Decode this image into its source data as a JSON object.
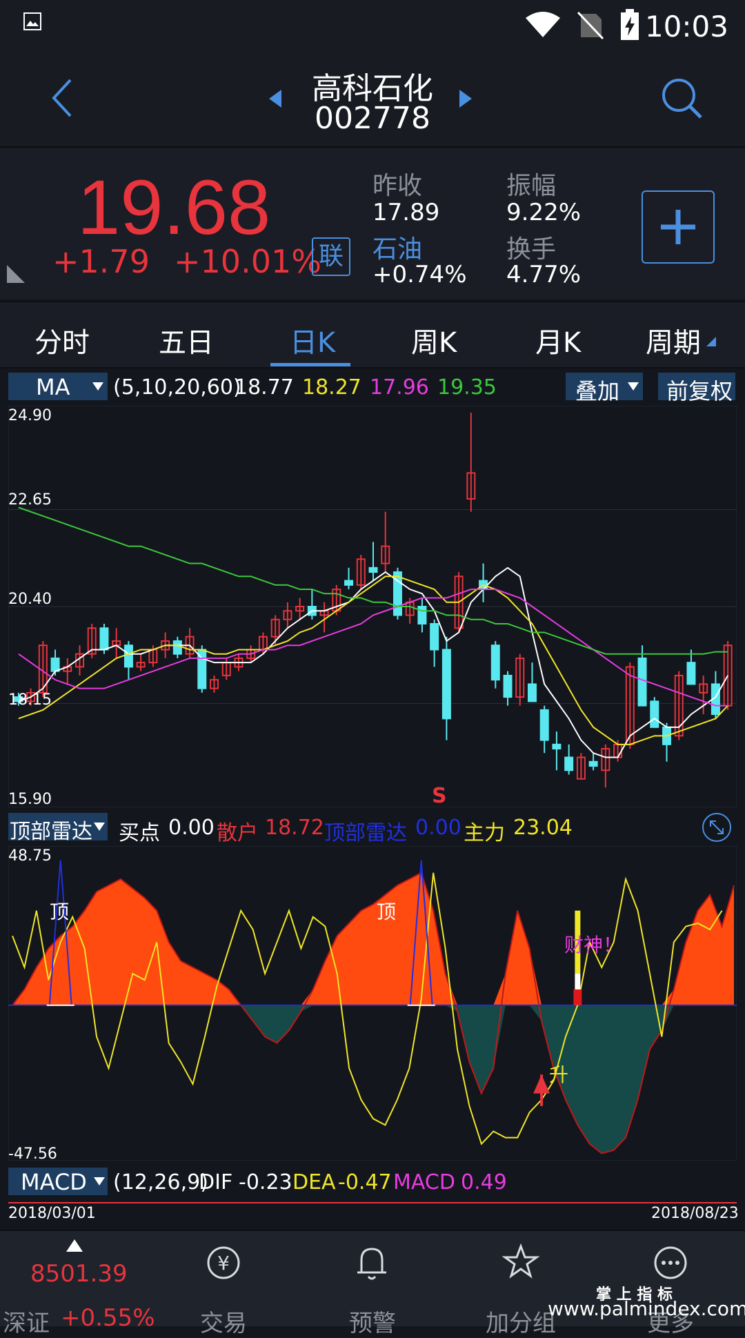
{
  "status": {
    "time": "10:03"
  },
  "nav": {
    "stock_name": "高科石化",
    "stock_code": "002778"
  },
  "quote": {
    "price": "19.68",
    "change": "+1.79",
    "change_pct": "+10.01%",
    "lian": "联",
    "prev_close_label": "昨收",
    "prev_close": "17.89",
    "amplitude_label": "振幅",
    "amplitude": "9.22%",
    "sector_label": "石油",
    "sector_change": "+0.74%",
    "turnover_label": "换手",
    "turnover": "4.77%"
  },
  "tabs": [
    "分时",
    "五日",
    "日K",
    "周K",
    "月K",
    "周期"
  ],
  "active_tab": 2,
  "ma_bar": {
    "selector": "MA",
    "params": "(5,10,20,60)",
    "v1": "18.77",
    "v2": "18.27",
    "v3": "17.96",
    "v4": "19.35",
    "overlay": "叠加",
    "adjust": "前复权"
  },
  "kline_axis": {
    "labels": [
      "24.90",
      "22.65",
      "20.40",
      "18.15",
      "15.90"
    ],
    "s_mark": "S"
  },
  "radar_bar": {
    "selector": "顶部雷达",
    "buy_label": "买点",
    "buy_val": "0.00",
    "retail_label": "散户",
    "retail_val": "18.72",
    "top_label": "顶部雷达",
    "top_val": "0.00",
    "main_label": "主力",
    "main_val": "23.04"
  },
  "radar_axis": {
    "top": "48.75",
    "bottom": "-47.56",
    "ding1": "顶",
    "ding2": "顶",
    "caishen": "财神！",
    "sheng": "升"
  },
  "macd_bar": {
    "selector": "MACD",
    "params": "(12,26,9)",
    "dif_label": "DIF",
    "dif": "-0.23",
    "dea_label": "DEA",
    "dea": "-0.47",
    "macd_label": "MACD",
    "macd": "0.49"
  },
  "dates": {
    "start": "2018/03/01",
    "end": "2018/08/23"
  },
  "bottom_nav": {
    "index_val": "8501.39",
    "index_name": "深证",
    "index_chg": "+0.55%",
    "trade": "交易",
    "alert": "预警",
    "group": "加分组",
    "more": "更多"
  },
  "watermark": {
    "line1": "掌 上 指 标",
    "line2": "www.palmindex.com"
  },
  "colors": {
    "up": "#e8343c",
    "down": "#59e8f0",
    "accent": "#4a8fe0",
    "ma5": "#ffffff",
    "ma10": "#f0e628",
    "ma20": "#e83ce0",
    "ma60": "#3cc83c"
  },
  "chart_data": {
    "type": "candlestick",
    "ylim": [
      15.9,
      24.9
    ],
    "ma_ylim_note": "",
    "candles": [
      [
        18.3,
        18.4,
        18.1,
        18.2
      ],
      [
        18.2,
        18.5,
        18.1,
        18.4
      ],
      [
        18.4,
        19.6,
        18.3,
        19.5
      ],
      [
        19.2,
        19.4,
        18.8,
        18.9
      ],
      [
        18.9,
        19.2,
        18.6,
        19.0
      ],
      [
        19.0,
        19.5,
        18.8,
        19.3
      ],
      [
        19.3,
        20.0,
        19.2,
        19.9
      ],
      [
        19.9,
        20.0,
        19.3,
        19.4
      ],
      [
        19.5,
        19.9,
        19.2,
        19.6
      ],
      [
        19.5,
        19.6,
        18.7,
        19.0
      ],
      [
        19.0,
        19.3,
        18.9,
        19.1
      ],
      [
        19.1,
        19.5,
        19.0,
        19.4
      ],
      [
        19.4,
        19.8,
        19.2,
        19.6
      ],
      [
        19.6,
        19.7,
        19.2,
        19.3
      ],
      [
        19.3,
        19.9,
        19.2,
        19.7
      ],
      [
        19.4,
        19.5,
        18.4,
        18.5
      ],
      [
        18.5,
        18.8,
        18.4,
        18.7
      ],
      [
        18.8,
        19.2,
        18.7,
        19.1
      ],
      [
        19.0,
        19.3,
        18.9,
        19.2
      ],
      [
        19.2,
        19.5,
        19.1,
        19.4
      ],
      [
        19.4,
        19.8,
        19.3,
        19.7
      ],
      [
        19.7,
        20.2,
        19.5,
        20.1
      ],
      [
        20.1,
        20.5,
        19.9,
        20.3
      ],
      [
        20.3,
        20.6,
        20.1,
        20.4
      ],
      [
        20.4,
        20.8,
        20.1,
        20.2
      ],
      [
        20.2,
        20.5,
        19.8,
        20.3
      ],
      [
        20.3,
        20.9,
        20.2,
        20.8
      ],
      [
        21.0,
        21.3,
        20.8,
        20.9
      ],
      [
        20.9,
        21.6,
        20.8,
        21.5
      ],
      [
        21.3,
        21.9,
        21.0,
        21.2
      ],
      [
        21.4,
        22.6,
        21.2,
        21.8
      ],
      [
        21.2,
        21.3,
        20.1,
        20.2
      ],
      [
        20.2,
        20.6,
        20.0,
        20.5
      ],
      [
        20.4,
        20.6,
        19.8,
        20.0
      ],
      [
        20.0,
        20.1,
        19.0,
        19.4
      ],
      [
        19.4,
        19.7,
        17.3,
        17.8
      ],
      [
        19.9,
        21.2,
        19.8,
        21.1
      ],
      [
        22.9,
        24.9,
        22.6,
        23.5
      ],
      [
        21.0,
        21.4,
        20.5,
        20.8
      ],
      [
        19.5,
        19.6,
        18.5,
        18.7
      ],
      [
        18.8,
        18.9,
        18.1,
        18.3
      ],
      [
        18.3,
        19.3,
        18.1,
        19.2
      ],
      [
        18.6,
        19.1,
        18.2,
        18.2
      ],
      [
        18.0,
        18.1,
        17.0,
        17.3
      ],
      [
        17.2,
        17.5,
        16.6,
        17.1
      ],
      [
        16.9,
        17.2,
        16.5,
        16.6
      ],
      [
        16.4,
        17.0,
        16.4,
        16.9
      ],
      [
        16.8,
        17.0,
        16.6,
        16.7
      ],
      [
        16.6,
        17.2,
        16.2,
        17.1
      ],
      [
        16.9,
        17.3,
        16.8,
        17.2
      ],
      [
        17.2,
        19.1,
        17.1,
        19.0
      ],
      [
        19.2,
        19.5,
        18.1,
        18.1
      ],
      [
        18.2,
        18.3,
        17.6,
        17.6
      ],
      [
        17.6,
        17.7,
        16.8,
        17.2
      ],
      [
        17.4,
        18.9,
        17.3,
        18.8
      ],
      [
        19.1,
        19.4,
        18.6,
        18.6
      ],
      [
        18.4,
        18.8,
        17.9,
        18.6
      ],
      [
        18.6,
        18.9,
        17.8,
        17.9
      ],
      [
        18.1,
        19.6,
        18.0,
        19.5
      ]
    ],
    "series": [
      {
        "name": "MA5",
        "values": [
          18.2,
          18.3,
          18.5,
          18.9,
          19.0,
          19.2,
          19.4,
          19.4,
          19.5,
          19.3,
          19.3,
          19.4,
          19.5,
          19.5,
          19.5,
          19.2,
          19.1,
          19.1,
          19.1,
          19.1,
          19.3,
          19.6,
          19.9,
          20.1,
          20.3,
          20.3,
          20.4,
          20.5,
          20.8,
          21.0,
          21.2,
          21.0,
          20.8,
          20.7,
          20.3,
          19.6,
          19.8,
          20.5,
          20.8,
          21.1,
          21.3,
          21.1,
          19.8,
          18.6,
          18.2,
          17.8,
          17.3,
          17.0,
          16.9,
          16.9,
          17.4,
          17.6,
          17.8,
          17.6,
          17.6,
          17.9,
          18.1,
          18.3,
          18.8
        ]
      },
      {
        "name": "MA10",
        "values": [
          17.8,
          17.9,
          18.0,
          18.2,
          18.4,
          18.6,
          18.8,
          19.0,
          19.2,
          19.3,
          19.4,
          19.4,
          19.5,
          19.5,
          19.4,
          19.4,
          19.3,
          19.3,
          19.4,
          19.4,
          19.4,
          19.5,
          19.6,
          19.8,
          19.9,
          20.1,
          20.3,
          20.5,
          20.7,
          20.9,
          21.1,
          21.1,
          21.0,
          20.9,
          20.8,
          20.5,
          20.5,
          20.7,
          20.9,
          20.8,
          20.6,
          20.3,
          20.0,
          19.5,
          19.0,
          18.5,
          18.0,
          17.6,
          17.4,
          17.2,
          17.2,
          17.3,
          17.4,
          17.4,
          17.5,
          17.6,
          17.7,
          17.8,
          18.1
        ]
      },
      {
        "name": "MA20",
        "values": [
          19.3,
          19.1,
          18.9,
          18.7,
          18.6,
          18.5,
          18.5,
          18.5,
          18.6,
          18.7,
          18.8,
          18.9,
          19.0,
          19.1,
          19.2,
          19.2,
          19.2,
          19.2,
          19.3,
          19.3,
          19.4,
          19.4,
          19.5,
          19.5,
          19.6,
          19.7,
          19.8,
          19.9,
          20.0,
          20.2,
          20.3,
          20.4,
          20.5,
          20.6,
          20.6,
          20.6,
          20.7,
          20.8,
          20.8,
          20.8,
          20.7,
          20.6,
          20.4,
          20.2,
          20.0,
          19.8,
          19.6,
          19.4,
          19.2,
          19.0,
          18.8,
          18.7,
          18.6,
          18.5,
          18.4,
          18.3,
          18.2,
          18.1,
          18.1
        ]
      },
      {
        "name": "MA60",
        "values": [
          22.7,
          22.6,
          22.5,
          22.4,
          22.3,
          22.2,
          22.1,
          22.0,
          21.9,
          21.8,
          21.8,
          21.7,
          21.6,
          21.5,
          21.4,
          21.4,
          21.3,
          21.2,
          21.1,
          21.1,
          21.0,
          20.9,
          20.9,
          20.8,
          20.8,
          20.7,
          20.7,
          20.6,
          20.6,
          20.5,
          20.5,
          20.4,
          20.4,
          20.3,
          20.3,
          20.2,
          20.2,
          20.1,
          20.1,
          20.0,
          20.0,
          19.9,
          19.8,
          19.8,
          19.7,
          19.6,
          19.5,
          19.4,
          19.3,
          19.3,
          19.3,
          19.3,
          19.3,
          19.3,
          19.3,
          19.3,
          19.3,
          19.35,
          19.35
        ]
      }
    ],
    "radar": {
      "ylim": [
        -47.56,
        48.75
      ],
      "area": [
        0,
        5,
        12,
        18,
        22,
        25,
        30,
        36,
        38,
        40,
        37,
        34,
        30,
        20,
        14,
        12,
        10,
        8,
        5,
        0,
        -5,
        -10,
        -12,
        -8,
        -2,
        5,
        14,
        22,
        26,
        30,
        32,
        35,
        38,
        40,
        42,
        30,
        10,
        -2,
        -18,
        -28,
        -20,
        10,
        30,
        18,
        -5,
        -20,
        -30,
        -38,
        -44,
        -47,
        -46,
        -42,
        -30,
        -14,
        -8,
        5,
        20,
        30,
        35,
        25,
        38
      ],
      "yellow": [
        22,
        12,
        30,
        8,
        20,
        28,
        18,
        -10,
        -20,
        -5,
        10,
        8,
        20,
        -12,
        -18,
        -25,
        -10,
        6,
        18,
        30,
        24,
        10,
        20,
        30,
        18,
        28,
        25,
        10,
        -20,
        -30,
        -36,
        -38,
        -30,
        -20,
        2,
        42,
        18,
        -14,
        -32,
        -44,
        -40,
        -42,
        -42,
        -34,
        -30,
        -24,
        -10,
        0,
        20,
        12,
        20,
        40,
        30,
        10,
        -10,
        20,
        25,
        26,
        24,
        30
      ],
      "blue": [
        0,
        0,
        0,
        0,
        46,
        0,
        0,
        0,
        0,
        0,
        0,
        0,
        0,
        0,
        0,
        0,
        0,
        0,
        0,
        0,
        0,
        0,
        0,
        0,
        0,
        0,
        0,
        0,
        0,
        0,
        0,
        0,
        0,
        0,
        46,
        0,
        0,
        0,
        0,
        0,
        0,
        0,
        0,
        0,
        0,
        0,
        0,
        0,
        0,
        0,
        0,
        0,
        0,
        0,
        0,
        0,
        0,
        0,
        0,
        0
      ]
    }
  }
}
